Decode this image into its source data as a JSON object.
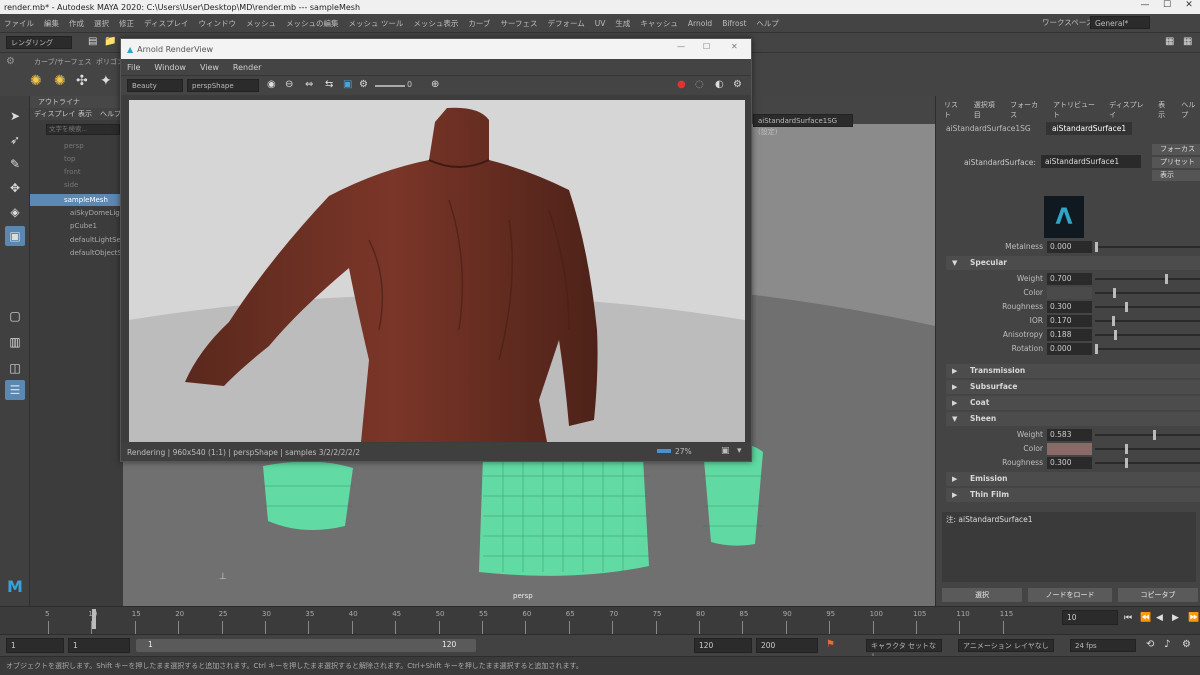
{
  "app": {
    "title": "render.mb* - Autodesk MAYA 2020: C:\\Users\\User\\Desktop\\MD\\render.mb  ---  sampleMesh",
    "workspace_label": "ワークスペース:",
    "workspace_value": "General*"
  },
  "menubar": [
    "ファイル",
    "編集",
    "作成",
    "選択",
    "修正",
    "ディスプレイ",
    "ウィンドウ",
    "メッシュ",
    "メッシュの編集",
    "メッシュ ツール",
    "メッシュ表示",
    "カーブ",
    "サーフェス",
    "デフォーム",
    "UV",
    "生成",
    "キャッシュ",
    "Arnold",
    "Bifrost",
    "ヘルプ"
  ],
  "shelf": {
    "mode": "レンダリング"
  },
  "shelf_tabs": [
    "カーブ/サーフェス",
    "ポリゴン"
  ],
  "outliner": {
    "menu_label": "ディスプレイ",
    "menu_label2": "表示",
    "menu_label3": "ヘルプ",
    "search_placeholder": "文字を検索...",
    "items": [
      "persp",
      "top",
      "front",
      "side",
      "sampleMesh",
      "aiSkyDomeLight",
      "pCube1",
      "defaultLightSet",
      "defaultObjectSet"
    ]
  },
  "render_view": {
    "title": "Arnold RenderView",
    "menu": [
      "File",
      "Window",
      "View",
      "Render"
    ],
    "aov": "Beauty",
    "camera": "perspShape",
    "exposure": "0",
    "status": "Rendering | 960x540 (1:1) | perspShape | samples 3/2/2/2/2/2",
    "zoom": "27%"
  },
  "viewport": {
    "material_dropdown": "aiStandardSurface1SG (設定)",
    "camera_label": "persp"
  },
  "attribute_editor": {
    "menu": [
      "リスト",
      "選択項目",
      "フォーカス",
      "アトリビュート",
      "ディスプレイ",
      "表示",
      "ヘルプ"
    ],
    "tabs": [
      "aiStandardSurface1SG",
      "aiStandardSurface1"
    ],
    "node_label": "aiStandardSurface:",
    "node_value": "aiStandardSurface1",
    "side_buttons": [
      "フォーカス",
      "プリセット",
      "表示"
    ],
    "metalness": {
      "label": "Metalness",
      "value": "0.000",
      "level": 0.0
    },
    "specular": {
      "title": "Specular",
      "weight": {
        "label": "Weight",
        "value": "0.700",
        "level": 0.7
      },
      "color": {
        "label": "Color",
        "swatch": "#4a4a4a"
      },
      "roughness": {
        "label": "Roughness",
        "value": "0.300",
        "level": 0.3
      },
      "ior": {
        "label": "IOR",
        "value": "0.170",
        "level": 0.17
      },
      "anisotropy": {
        "label": "Anisotropy",
        "value": "0.188",
        "level": 0.188
      },
      "rotation": {
        "label": "Rotation",
        "value": "0.000",
        "level": 0.0
      }
    },
    "sections_collapsed": [
      "Transmission",
      "Subsurface",
      "Coat"
    ],
    "sheen": {
      "title": "Sheen",
      "weight": {
        "label": "Weight",
        "value": "0.583",
        "level": 0.583
      },
      "color": {
        "label": "Color",
        "swatch": "#8a6a66"
      },
      "roughness": {
        "label": "Roughness",
        "value": "0.300",
        "level": 0.3
      }
    },
    "sections_after": [
      "Emission",
      "Thin Film"
    ],
    "notes_label": "注: aiStandardSurface1",
    "bottom_buttons": [
      "選択",
      "ノードをロード",
      "コピータブ"
    ]
  },
  "timeline": {
    "ticks": [
      "5",
      "10",
      "15",
      "20",
      "25",
      "30",
      "35",
      "40",
      "45",
      "50",
      "55",
      "60",
      "65",
      "70",
      "75",
      "80",
      "85",
      "90",
      "95",
      "100",
      "105",
      "110",
      "115"
    ],
    "current_frame": "10"
  },
  "range": {
    "start": "1",
    "start2": "1",
    "inner_start": "1",
    "inner_end": "120",
    "end": "120",
    "end2": "200",
    "char_set": "キャラクタ セットなし",
    "anim_layer": "アニメーション レイヤなし",
    "fps": "24 fps"
  },
  "helpline": "オブジェクトを選択します。Shift キーを押したまま選択すると追加されます。Ctrl キーを押したまま選択すると解除されます。Ctrl+Shift キーを押したまま選択すると追加されます。",
  "colors": {
    "shirt": "#6b2f22",
    "wire": "#5fe6a8",
    "arnold_accent": "#2ea6c8"
  }
}
